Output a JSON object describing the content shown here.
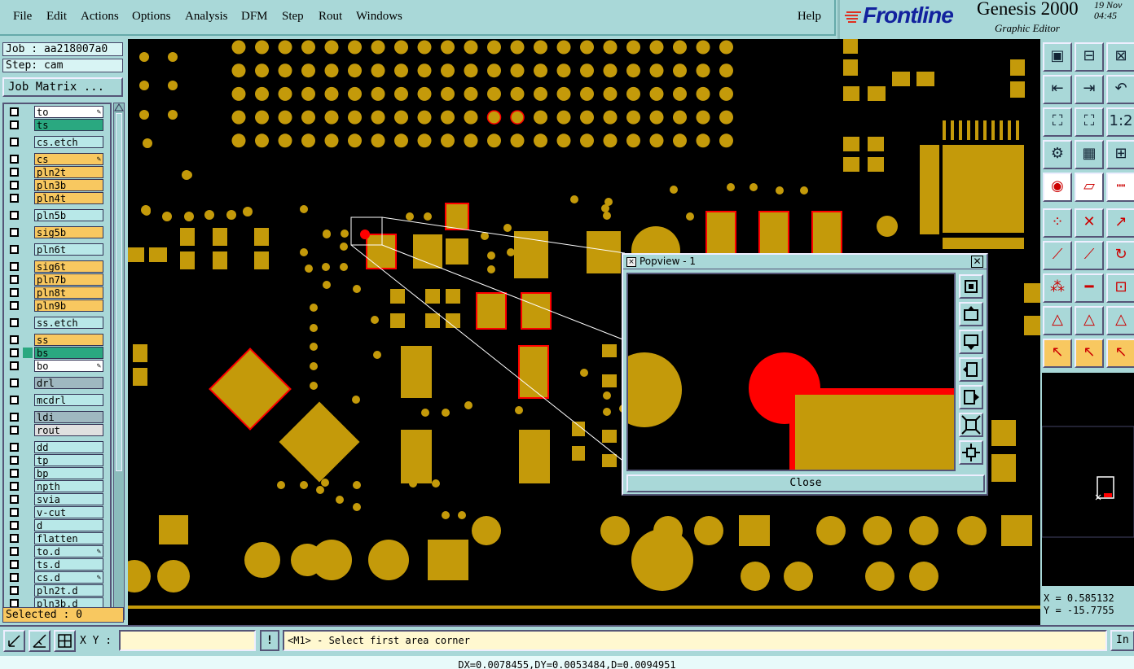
{
  "menu": {
    "items": [
      {
        "key": "file",
        "label": "File"
      },
      {
        "key": "edit",
        "label": "Edit"
      },
      {
        "key": "actions",
        "label": "Actions"
      },
      {
        "key": "options",
        "label": "Options"
      },
      {
        "key": "analysis",
        "label": "Analysis"
      },
      {
        "key": "dfm",
        "label": "DFM"
      },
      {
        "key": "step",
        "label": "Step"
      },
      {
        "key": "rout",
        "label": "Rout"
      },
      {
        "key": "windows",
        "label": "Windows"
      }
    ],
    "help": "Help"
  },
  "brand": {
    "logo": "Frontline",
    "product": "Genesis 2000",
    "subtitle": "Graphic Editor",
    "date_line1": "19  Nov",
    "date_line2": "04:45"
  },
  "job": {
    "job_label": "Job : aa218007a0",
    "step_label": "Step: cam",
    "matrix_button": "Job Matrix ..."
  },
  "layers": [
    {
      "name": "to",
      "color": "#ffffff",
      "pen": true,
      "swatch": ""
    },
    {
      "name": "ts",
      "color": "#2aa880",
      "pen": false,
      "swatch": ""
    },
    {
      "name": "cs.etch",
      "color": "#b8e8e8",
      "pen": false,
      "swatch": ""
    },
    {
      "name": "cs",
      "color": "#f8c860",
      "pen": true,
      "swatch": ""
    },
    {
      "name": "pln2t",
      "color": "#f8c860",
      "pen": false,
      "swatch": ""
    },
    {
      "name": "pln3b",
      "color": "#f8c860",
      "pen": false,
      "swatch": ""
    },
    {
      "name": "pln4t",
      "color": "#f8c860",
      "pen": false,
      "swatch": ""
    },
    {
      "name": "pln5b",
      "color": "#b8e8e8",
      "pen": false,
      "swatch": ""
    },
    {
      "name": "sig5b",
      "color": "#f8c860",
      "pen": false,
      "swatch": ""
    },
    {
      "name": "pln6t",
      "color": "#b8e8e8",
      "pen": false,
      "swatch": ""
    },
    {
      "name": "sig6t",
      "color": "#f8c860",
      "pen": false,
      "swatch": ""
    },
    {
      "name": "pln7b",
      "color": "#f8c860",
      "pen": false,
      "swatch": ""
    },
    {
      "name": "pln8t",
      "color": "#f8c860",
      "pen": false,
      "swatch": ""
    },
    {
      "name": "pln9b",
      "color": "#f8c860",
      "pen": false,
      "swatch": ""
    },
    {
      "name": "ss.etch",
      "color": "#b8e8e8",
      "pen": false,
      "swatch": ""
    },
    {
      "name": "ss",
      "color": "#f8c860",
      "pen": false,
      "swatch": ""
    },
    {
      "name": "bs",
      "color": "#2aa880",
      "pen": false,
      "swatch": "#2aa880"
    },
    {
      "name": "bo",
      "color": "#ffffff",
      "pen": true,
      "swatch": ""
    },
    {
      "name": "drl",
      "color": "#9fb8c0",
      "pen": false,
      "swatch": ""
    },
    {
      "name": "mcdrl",
      "color": "#b8e8e8",
      "pen": false,
      "swatch": ""
    },
    {
      "name": "ldi",
      "color": "#9fb8c0",
      "pen": false,
      "swatch": ""
    },
    {
      "name": "rout",
      "color": "#e0e0e0",
      "pen": false,
      "swatch": ""
    },
    {
      "name": "dd",
      "color": "#b8e8e8",
      "pen": false,
      "swatch": ""
    },
    {
      "name": "tp",
      "color": "#b8e8e8",
      "pen": false,
      "swatch": ""
    },
    {
      "name": "bp",
      "color": "#b8e8e8",
      "pen": false,
      "swatch": ""
    },
    {
      "name": "npth",
      "color": "#b8e8e8",
      "pen": false,
      "swatch": ""
    },
    {
      "name": "svia",
      "color": "#b8e8e8",
      "pen": false,
      "swatch": ""
    },
    {
      "name": "v-cut",
      "color": "#b8e8e8",
      "pen": false,
      "swatch": ""
    },
    {
      "name": "d",
      "color": "#b8e8e8",
      "pen": false,
      "swatch": ""
    },
    {
      "name": "flatten",
      "color": "#b8e8e8",
      "pen": false,
      "swatch": ""
    },
    {
      "name": "to.d",
      "color": "#b8e8e8",
      "pen": true,
      "swatch": ""
    },
    {
      "name": "ts.d",
      "color": "#b8e8e8",
      "pen": false,
      "swatch": ""
    },
    {
      "name": "cs.d",
      "color": "#b8e8e8",
      "pen": true,
      "swatch": ""
    },
    {
      "name": "pln2t.d",
      "color": "#b8e8e8",
      "pen": false,
      "swatch": ""
    },
    {
      "name": "pln3b.d",
      "color": "#b8e8e8",
      "pen": false,
      "swatch": ""
    }
  ],
  "selected": "Selected : 0",
  "popview": {
    "title": "Popview - 1",
    "close": "Close"
  },
  "coords": {
    "x": "X = 0.585132",
    "y": "Y = -15.7755"
  },
  "bottom": {
    "xy_label": "X Y :",
    "xy_value": "",
    "excl": "!",
    "prompt": "<M1> - Select first area corner",
    "in_button": "In"
  },
  "status": "DX=0.0078455,DY=0.0053484,D=0.0094951",
  "colors": {
    "copper": "#c49a0a",
    "highlight": "#ff0000",
    "panel": "#a9d8d8"
  }
}
